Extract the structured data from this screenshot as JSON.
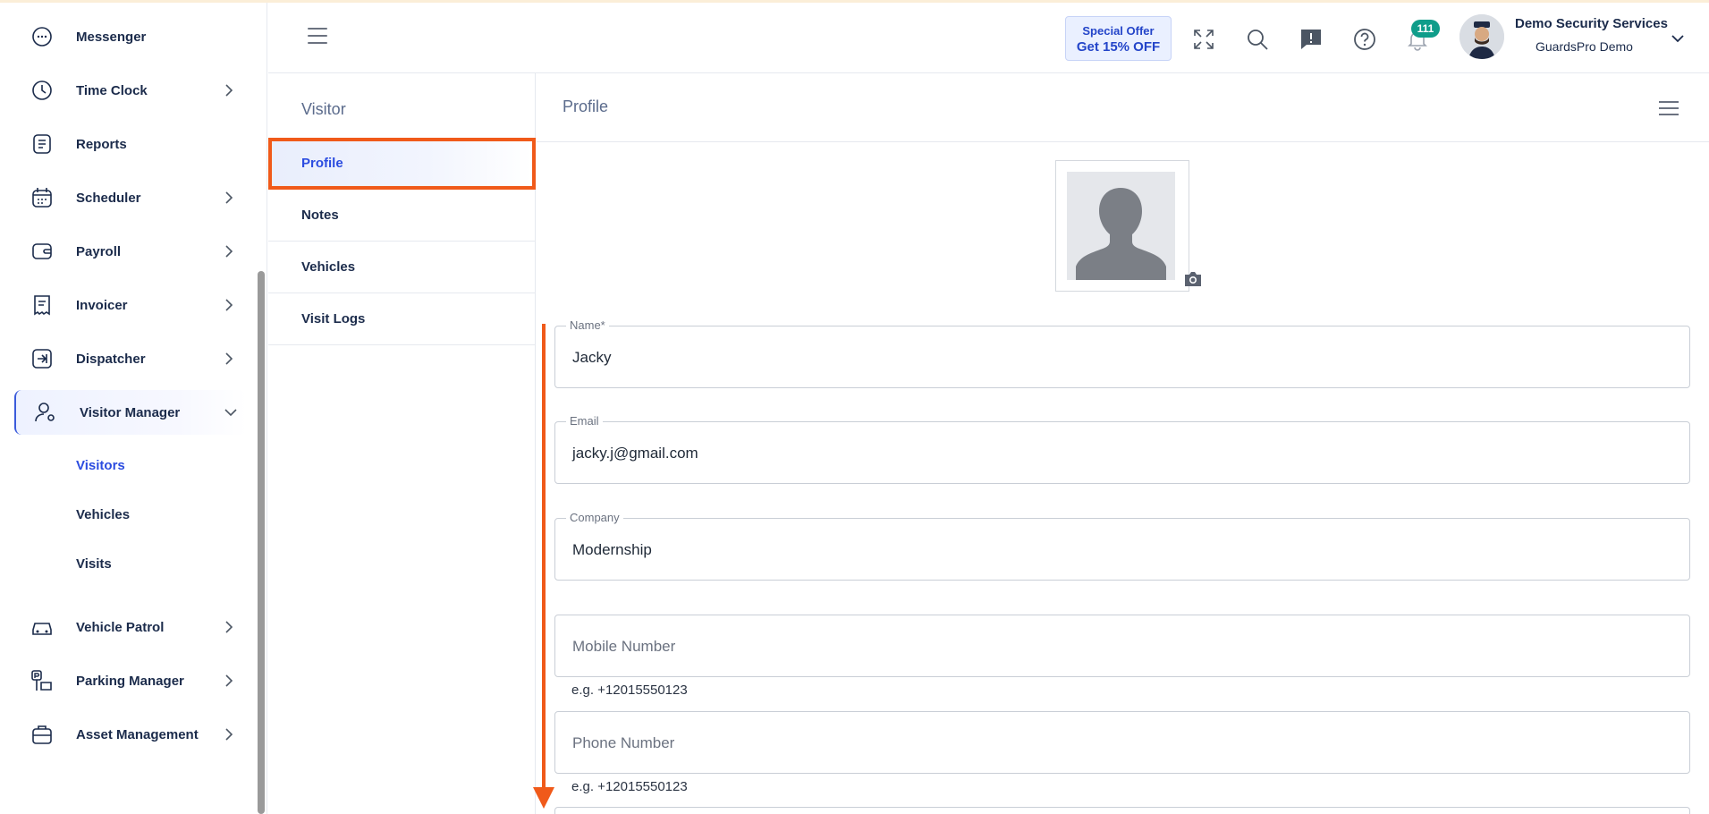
{
  "sidebar": {
    "items": [
      {
        "label": "Messenger",
        "icon": "chat-bubble-icon"
      },
      {
        "label": "Time Clock",
        "icon": "clock-icon"
      },
      {
        "label": "Reports",
        "icon": "report-icon"
      },
      {
        "label": "Scheduler",
        "icon": "calendar-icon"
      },
      {
        "label": "Payroll",
        "icon": "wallet-icon"
      },
      {
        "label": "Invoicer",
        "icon": "receipt-icon"
      },
      {
        "label": "Dispatcher",
        "icon": "dispatch-icon"
      },
      {
        "label": "Visitor Manager",
        "icon": "user-gear-icon"
      },
      {
        "label": "Vehicle Patrol",
        "icon": "car-icon"
      },
      {
        "label": "Parking Manager",
        "icon": "parking-icon"
      },
      {
        "label": "Asset Management",
        "icon": "briefcase-icon"
      }
    ],
    "visitor_sub": [
      "Visitors",
      "Vehicles",
      "Visits"
    ]
  },
  "header": {
    "offer_line1": "Special Offer",
    "offer_line2": "Get 15% OFF",
    "notification_count": "111",
    "user_name": "Demo Security Services",
    "user_org": "GuardsPro Demo"
  },
  "subnav": {
    "title": "Visitor",
    "items": [
      "Profile",
      "Notes",
      "Vehicles",
      "Visit Logs"
    ]
  },
  "main": {
    "title": "Profile",
    "fields": [
      {
        "label": "Name*",
        "value": "Jacky"
      },
      {
        "label": "Email",
        "value": "jacky.j@gmail.com"
      },
      {
        "label": "Company",
        "value": "Modernship"
      }
    ],
    "mobile_placeholder": "Mobile Number",
    "mobile_hint": "e.g. +12015550123",
    "phone_placeholder": "Phone Number",
    "phone_hint": "e.g. +12015550123"
  },
  "colors": {
    "accent": "#2b4ce0",
    "highlight": "#f05a1a",
    "badge": "#0f9d8a"
  }
}
